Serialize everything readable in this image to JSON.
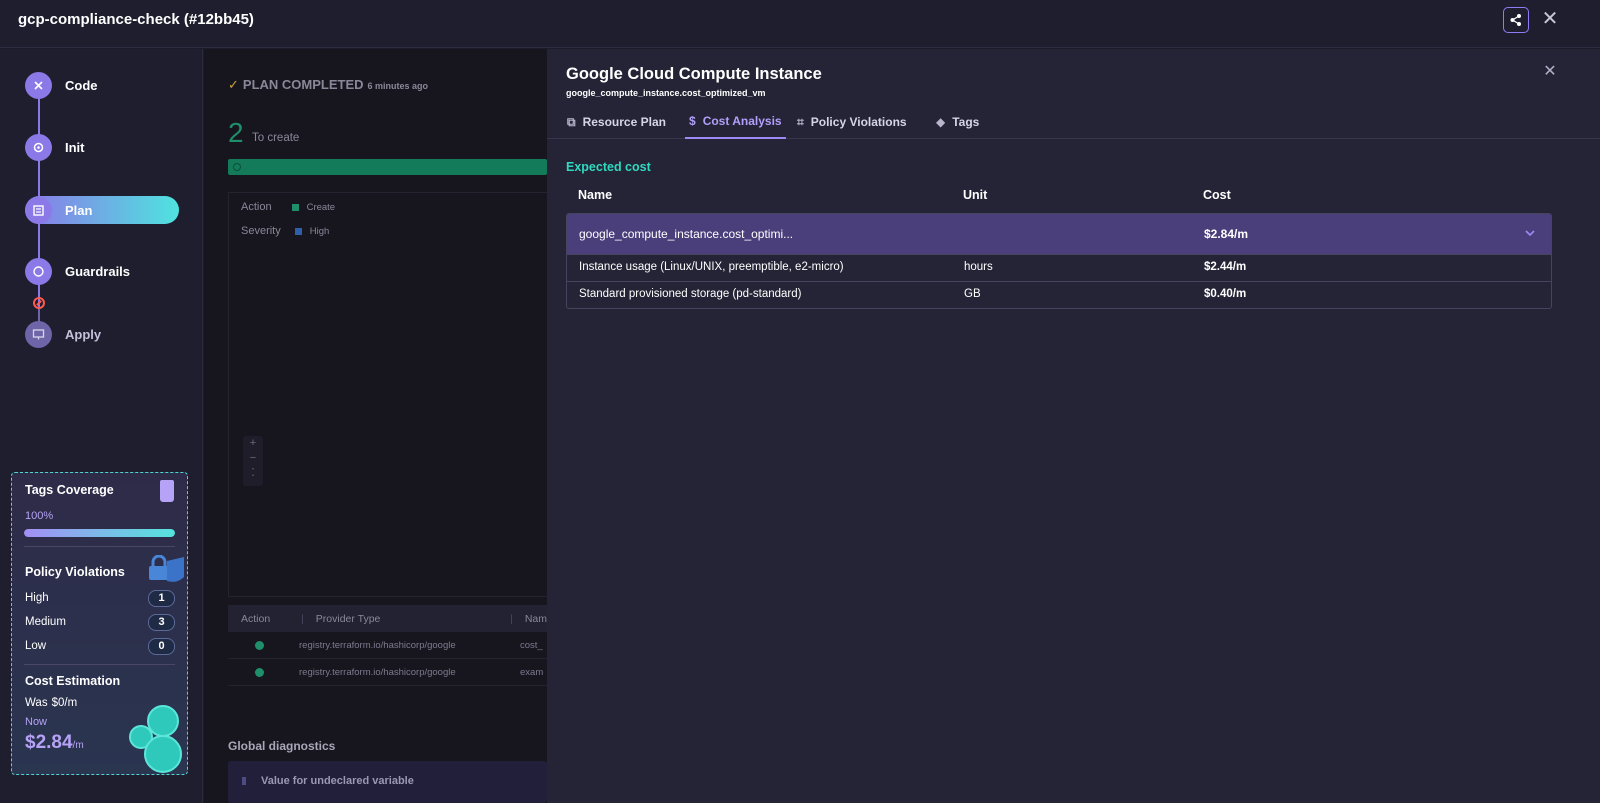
{
  "window": {
    "title": "gcp-compliance-check (#12bb45)"
  },
  "pipeline": {
    "steps": [
      {
        "label": "Code"
      },
      {
        "label": "Init"
      },
      {
        "label": "Plan"
      },
      {
        "label": "Guardrails"
      },
      {
        "label": "Apply"
      }
    ]
  },
  "summary": {
    "tags_coverage": {
      "title": "Tags Coverage",
      "percent_label": "100%",
      "percent": 100
    },
    "policy_violations": {
      "title": "Policy Violations",
      "rows": [
        {
          "label": "High",
          "count": "1"
        },
        {
          "label": "Medium",
          "count": "3"
        },
        {
          "label": "Low",
          "count": "0"
        }
      ]
    },
    "cost_estimation": {
      "title": "Cost Estimation",
      "was_label": "Was",
      "was_value": "$0/m",
      "now_label": "Now",
      "now_value": "$2.84",
      "now_unit": "/m"
    }
  },
  "plan": {
    "status": "PLAN COMPLETED",
    "status_time": "6 minutes ago",
    "to_create_count": "2",
    "to_create_label": "To create",
    "filters": [
      {
        "label": "Action",
        "value": "Create",
        "color": "#1e8f6a"
      },
      {
        "label": "Severity",
        "value": "High",
        "color": "#2f5fa8"
      }
    ],
    "table": {
      "headers": [
        "Action",
        "Provider Type",
        "Nam"
      ],
      "rows": [
        {
          "provider": "registry.terraform.io/hashicorp/google",
          "name": "cost_"
        },
        {
          "provider": "registry.terraform.io/hashicorp/google",
          "name": "exam"
        }
      ]
    },
    "global_diagnostics": "Global diagnostics",
    "diagnostic_item": "Value for undeclared variable"
  },
  "panel": {
    "title": "Google Cloud Compute Instance",
    "subtitle": "google_compute_instance.cost_optimized_vm",
    "tabs": [
      {
        "label": "Resource Plan",
        "icon": "resource-plan-icon"
      },
      {
        "label": "Cost Analysis",
        "icon": "dollar-icon",
        "active": true
      },
      {
        "label": "Policy Violations",
        "icon": "scan-icon"
      },
      {
        "label": "Tags",
        "icon": "tag-icon"
      }
    ],
    "cost": {
      "section_title": "Expected cost",
      "columns": [
        "Name",
        "Unit",
        "Cost"
      ],
      "group": {
        "name": "google_compute_instance.cost_optimi...",
        "cost": "$2.84/m"
      },
      "items": [
        {
          "name": "Instance usage (Linux/UNIX, preemptible, e2-micro)",
          "unit": "hours",
          "cost": "$2.44/m"
        },
        {
          "name": "Standard provisioned storage (pd-standard)",
          "unit": "GB",
          "cost": "$0.40/m"
        }
      ]
    }
  },
  "colors": {
    "accent": "#8b79e8",
    "teal": "#4fe3df",
    "panel_bg": "#252436",
    "expected_cost": "#2fd9c0"
  }
}
